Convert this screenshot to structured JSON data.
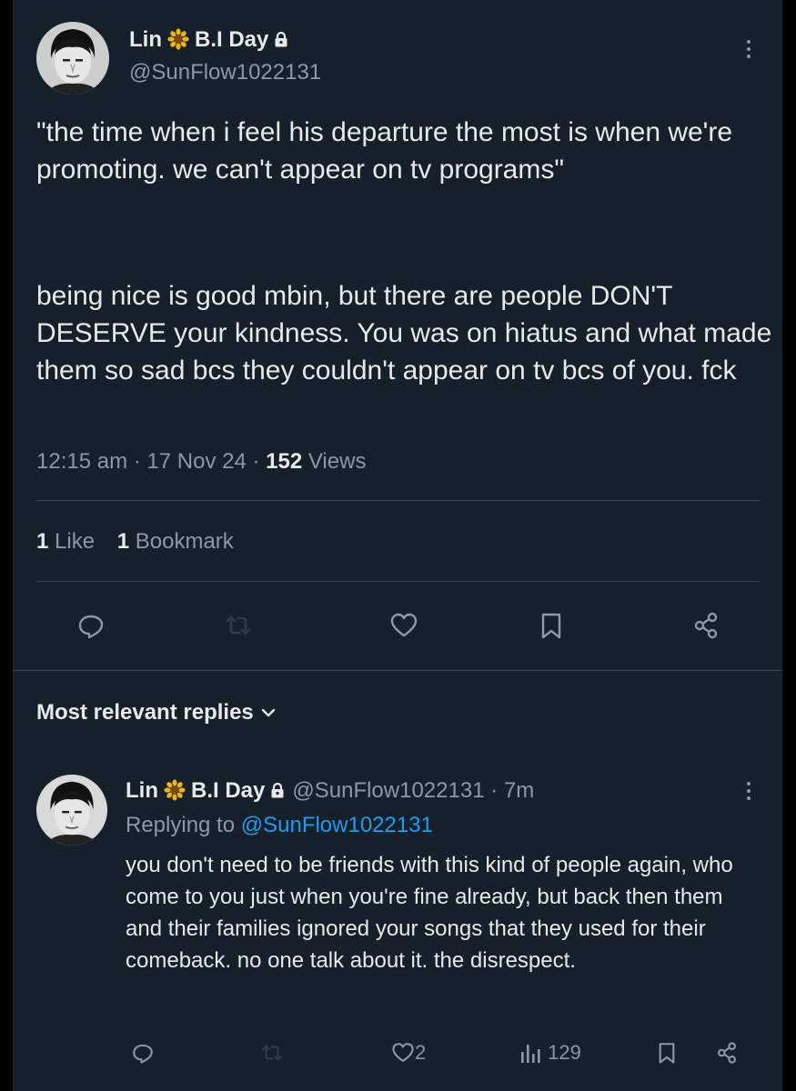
{
  "tweet": {
    "display_name": "Lin",
    "name_suffix": "B.I Day",
    "handle": "@SunFlow1022131",
    "paragraph_1": "\"the time when i feel his departure the most is when we're promoting. we can't appear on tv programs\"",
    "paragraph_2": "being nice is good mbin, but there are people DON'T DESERVE your kindness. You was on hiatus and what made them so sad bcs they couldn't appear on tv bcs of you. fck",
    "time": "12:15 am",
    "date": "17 Nov 24",
    "views_count": "152",
    "views_label": "Views",
    "likes_count": "1",
    "likes_label": "Like",
    "bookmarks_count": "1",
    "bookmarks_label": "Bookmark"
  },
  "replies_header": "Most relevant replies",
  "reply": {
    "display_name": "Lin",
    "name_suffix": "B.I Day",
    "handle": "@SunFlow1022131",
    "age": "7m",
    "replying_prefix": "Replying to",
    "replying_to": "@SunFlow1022131",
    "text": "you don't need to be friends with this kind of people again, who come to you just when you're fine already, but back then them and their families ignored your songs that they used for their comeback. no one talk about it. the disrespect.",
    "likes": "2",
    "views": "129"
  },
  "icons": {
    "name_badge": "sunflower-icon",
    "protected": "lock-icon",
    "more": "more-vertical-icon",
    "reply": "reply-icon",
    "retweet": "retweet-icon",
    "like": "heart-icon",
    "bookmark": "bookmark-icon",
    "share": "share-icon",
    "views": "views-bars-icon",
    "dropdown": "chevron-down-icon"
  },
  "colors": {
    "background": "#15202b",
    "text": "#e7e9ea",
    "secondary": "#8b98a5",
    "link": "#1d9bf0",
    "divider": "#38444d"
  }
}
